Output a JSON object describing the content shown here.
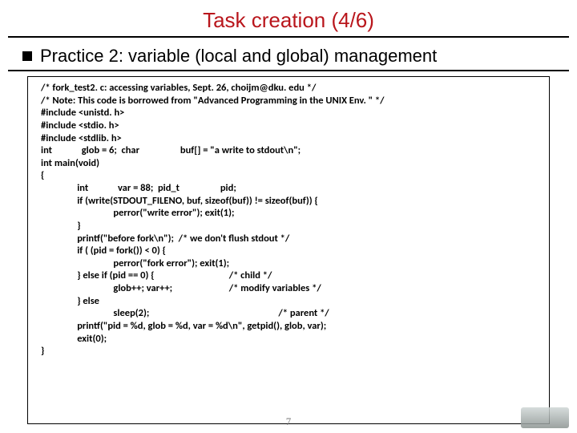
{
  "slide": {
    "title": "Task creation (4/6)",
    "subtitle": "Practice 2: variable (local and global) management",
    "page_number": "7"
  },
  "code": {
    "l01": "/* fork_test2. c: accessing variables, Sept. 26, choijm@dku. edu */",
    "l02": "/* Note: This code is borrowed from \"Advanced Programming in the UNIX Env. \" */",
    "l03": "#include <unistd. h>",
    "l04": "#include <stdio. h>",
    "l05": "#include <stdlib. h>",
    "l06": "",
    "l07": "int             glob = 6;  char                  buf[] = \"a write to stdout\\n\";",
    "l08": "",
    "l09": "int main(void)",
    "l10": "{",
    "l11": "                int             var = 88;  pid_t                  pid;",
    "l12": "",
    "l13": "                if (write(STDOUT_FILENO, buf, sizeof(buf)) != sizeof(buf)) {",
    "l14": "                                perror(\"write error\"); exit(1);",
    "l15": "                }",
    "l16": "                printf(\"before fork\\n\");  /* we don't flush stdout */",
    "l17": "",
    "l18": "                if ( (pid = fork()) < 0) {",
    "l19": "                                perror(\"fork error\"); exit(1);",
    "l20": "                } else if (pid == 0) {                                 /* child */",
    "l21": "                                glob++; var++;                         /* modify variables */",
    "l22": "                } else",
    "l23": "                                sleep(2);                                                         /* parent */",
    "l24": "                printf(\"pid = %d, glob = %d, var = %d\\n\", getpid(), glob, var);",
    "l25": "                exit(0);",
    "l26": "}"
  }
}
